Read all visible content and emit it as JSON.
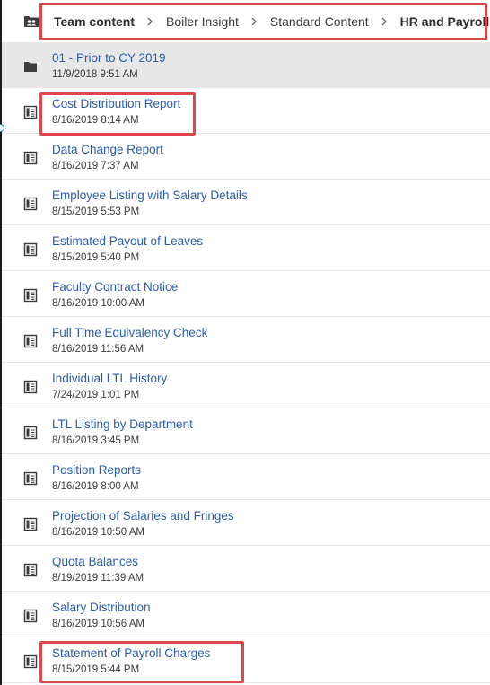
{
  "breadcrumb": {
    "root_icon": "team-content-icon",
    "items": [
      {
        "label": "Team content"
      },
      {
        "label": "Boiler Insight"
      },
      {
        "label": "Standard Content"
      },
      {
        "label": "HR and Payroll"
      }
    ]
  },
  "list": {
    "items": [
      {
        "title": "01 - Prior to CY 2019",
        "date": "11/9/2018 9:51 AM",
        "icon": "folder-icon"
      },
      {
        "title": "Cost Distribution Report",
        "date": "8/16/2019 8:14 AM",
        "icon": "report-icon"
      },
      {
        "title": "Data Change Report",
        "date": "8/16/2019 7:37 AM",
        "icon": "report-icon"
      },
      {
        "title": "Employee Listing with Salary Details",
        "date": "8/15/2019 5:53 PM",
        "icon": "report-icon"
      },
      {
        "title": "Estimated Payout of Leaves",
        "date": "8/15/2019 5:40 PM",
        "icon": "report-icon"
      },
      {
        "title": "Faculty Contract Notice",
        "date": "8/16/2019 10:00 AM",
        "icon": "report-icon"
      },
      {
        "title": "Full Time Equivalency Check",
        "date": "8/16/2019 11:56 AM",
        "icon": "report-icon"
      },
      {
        "title": "Individual LTL History",
        "date": "7/24/2019 1:01 PM",
        "icon": "report-icon"
      },
      {
        "title": "LTL Listing by Department",
        "date": "8/16/2019 3:45 PM",
        "icon": "report-icon"
      },
      {
        "title": "Position Reports",
        "date": "8/16/2019 8:00 AM",
        "icon": "report-icon"
      },
      {
        "title": "Projection of Salaries and Fringes",
        "date": "8/16/2019 10:50 AM",
        "icon": "report-icon"
      },
      {
        "title": "Quota Balances",
        "date": "8/19/2019 11:39 AM",
        "icon": "report-icon"
      },
      {
        "title": "Salary Distribution",
        "date": "8/16/2019 10:56 AM",
        "icon": "report-icon"
      },
      {
        "title": "Statement of Payroll Charges",
        "date": "8/15/2019 5:44 PM",
        "icon": "report-icon"
      }
    ]
  },
  "colors": {
    "link": "#2a5ca8",
    "folder_row_bg": "#e7e7e7",
    "highlight": "#e0474c"
  }
}
